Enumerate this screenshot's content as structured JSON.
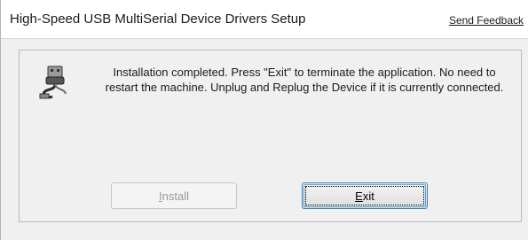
{
  "window": {
    "title": "High-Speed USB MultiSerial Device Drivers Setup",
    "feedback_link": "Send Feedback"
  },
  "content": {
    "icon": "usb-plug-icon",
    "message": "Installation completed. Press \"Exit\" to terminate the application. No need to restart the machine. Unplug and Replug the Device if it is currently connected."
  },
  "buttons": {
    "install": {
      "mnemonic": "I",
      "rest": "nstall",
      "enabled": false
    },
    "exit": {
      "mnemonic": "E",
      "rest": "xit",
      "enabled": true
    }
  }
}
